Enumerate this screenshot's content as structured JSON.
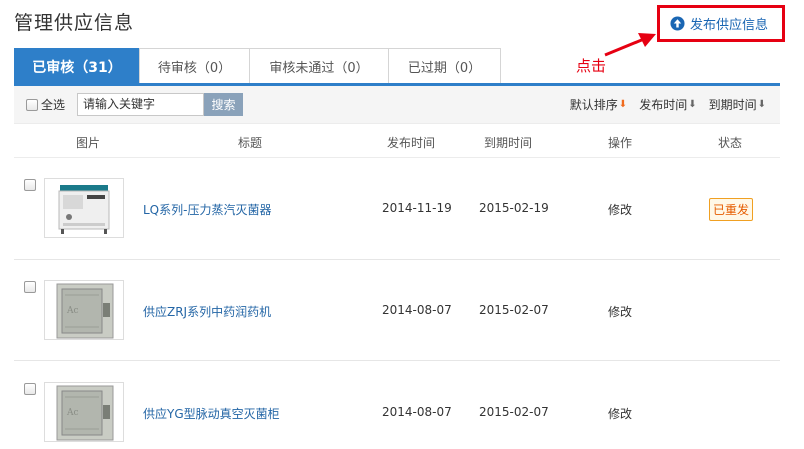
{
  "page": {
    "title": "管理供应信息"
  },
  "publish": {
    "label": "发布供应信息",
    "icon": "arrow-up-circle-icon"
  },
  "annotation": {
    "note": "点击"
  },
  "tabs": [
    {
      "label": "已审核（31）",
      "active": true
    },
    {
      "label": "待审核（0）",
      "active": false
    },
    {
      "label": "审核未通过（0）",
      "active": false
    },
    {
      "label": "已过期（0）",
      "active": false
    }
  ],
  "toolbar": {
    "select_all": "全选",
    "search_placeholder": "请输入关键字",
    "search_button": "搜索",
    "sorts": [
      "默认排序",
      "发布时间",
      "到期时间"
    ]
  },
  "table": {
    "columns": [
      "图片",
      "标题",
      "发布时间",
      "到期时间",
      "操作",
      "状态"
    ],
    "rows": [
      {
        "title": "LQ系列-压力蒸汽灭菌器",
        "publish_date": "2014-11-19",
        "expire_date": "2015-02-19",
        "action": "修改",
        "status": "已重发"
      },
      {
        "title": "供应ZRJ系列中药润药机",
        "publish_date": "2014-08-07",
        "expire_date": "2015-02-07",
        "action": "修改",
        "status": ""
      },
      {
        "title": "供应YG型脉动真空灭菌柜",
        "publish_date": "2014-08-07",
        "expire_date": "2015-02-07",
        "action": "修改",
        "status": ""
      }
    ]
  },
  "colors": {
    "accent": "#2e7fc9",
    "highlight_red": "#e60012",
    "link": "#2466a6"
  }
}
